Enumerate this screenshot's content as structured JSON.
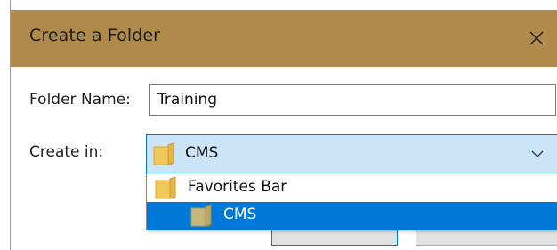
{
  "dialog": {
    "title": "Create a Folder",
    "close_glyph": "✕"
  },
  "form": {
    "folder_name_label": "Folder Name:",
    "folder_name_value": "Training",
    "create_in_label": "Create in:",
    "create_in_selected": "CMS"
  },
  "dropdown": {
    "options": [
      {
        "label": "Favorites Bar",
        "icon": "folder-icon",
        "selected": false
      },
      {
        "label": "CMS",
        "icon": "folder-icon",
        "selected": true
      }
    ]
  },
  "colors": {
    "titlebar": "#b08a4a",
    "combo_background": "#cce4f7",
    "accent": "#0078d7",
    "folder_yellow": "#f1c95a",
    "folder_muted": "#c8b77a"
  }
}
